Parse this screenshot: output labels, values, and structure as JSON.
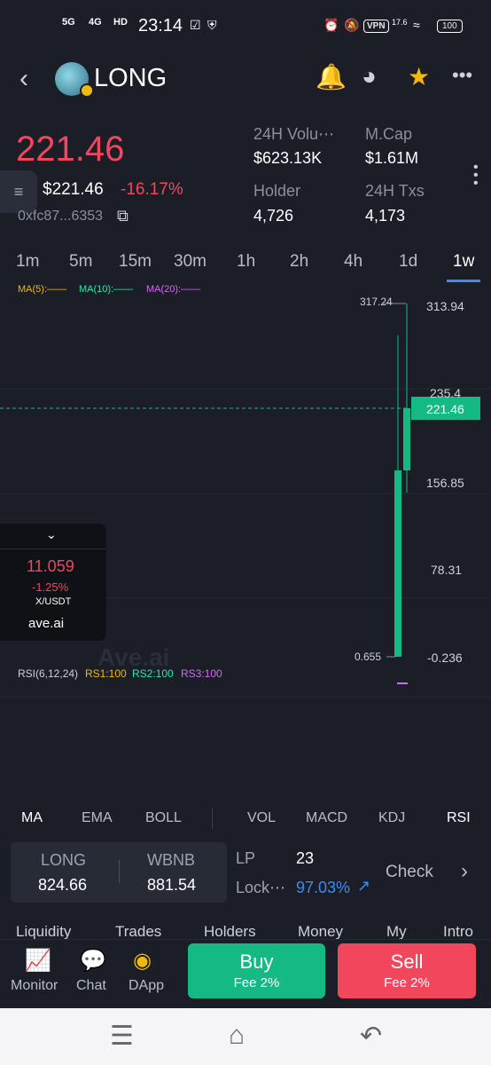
{
  "status": {
    "time": "23:14",
    "net1": "5G",
    "net2": "4G",
    "hd": "HD",
    "vpn": "VPN",
    "speed": "17.6",
    "battery": "100"
  },
  "header": {
    "token": "LONG"
  },
  "price": {
    "main": "221.46",
    "usd": "$221.46",
    "change": "-16.17%",
    "address": "0xfc87...6353"
  },
  "stats": {
    "vol_label": "24H Volu⋯",
    "vol": "$623.13K",
    "mcap_label": "M.Cap",
    "mcap": "$1.61M",
    "holder_label": "Holder",
    "holder": "4,726",
    "txs_label": "24H Txs",
    "txs": "4,173"
  },
  "timeframes": [
    "1m",
    "5m",
    "15m",
    "30m",
    "1h",
    "2h",
    "4h",
    "1d",
    "1w"
  ],
  "chart": {
    "ma5": "MA(5):——",
    "ma10": "MA(10):——",
    "ma20": "MA(20):——",
    "ma5_color": "#f0b90b",
    "ma10_color": "#2ee6a8",
    "ma20_color": "#d26bf2",
    "high_label": "317.24",
    "low_label": "0.655",
    "y_ticks": [
      "313.94",
      "235.4",
      "156.85",
      "78.31",
      "-0.236"
    ],
    "current": "221.46",
    "watermark": "Ave.ai",
    "rsi": "RSI(6,12,24)",
    "rs1": "RS1:100",
    "rs2": "RS2:100",
    "rs3": "RS3:100"
  },
  "popup": {
    "price": "11.059",
    "change": "-1.25%",
    "pair": "X/USDT",
    "brand": "ave.ai"
  },
  "indicators_left": [
    "MA",
    "EMA",
    "BOLL"
  ],
  "indicators_right": [
    "VOL",
    "MACD",
    "KDJ",
    "RSI"
  ],
  "pool": {
    "token_a": "LONG",
    "amount_a": "824.66",
    "token_b": "WBNB",
    "amount_b": "881.54",
    "lp_label": "LP",
    "lp_value": "23",
    "lock_label": "Lock⋯",
    "lock_value": "97.03%",
    "check": "Check"
  },
  "bottom_tabs": [
    "Liquidity",
    "Trades",
    "Holders",
    "Money",
    "My",
    "Intro"
  ],
  "actionbar": {
    "monitor": "Monitor",
    "chat": "Chat",
    "dapp": "DApp",
    "buy": "Buy",
    "buy_fee": "Fee 2%",
    "sell": "Sell",
    "sell_fee": "Fee 2%"
  }
}
